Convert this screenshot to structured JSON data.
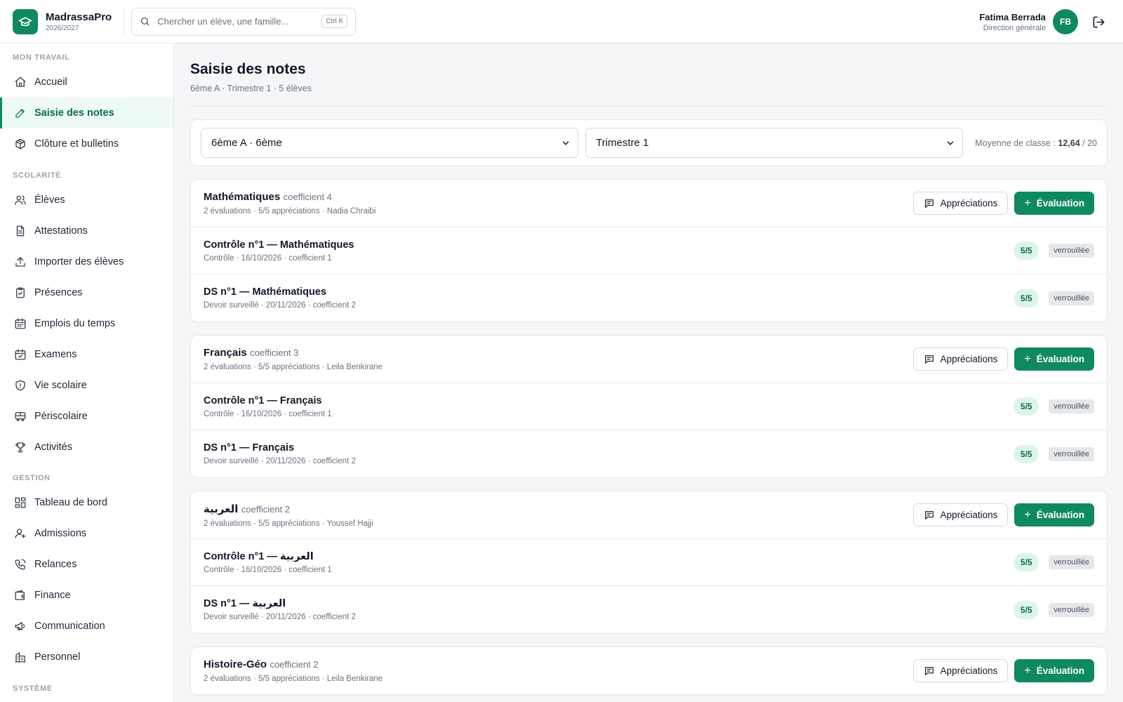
{
  "app": {
    "name": "MadrassaPro",
    "year": "2026/2027"
  },
  "search": {
    "placeholder": "Chercher un élève, une famille...",
    "shortcut": "Ctrl K"
  },
  "user": {
    "name": "Fatima Berrada",
    "role": "Direction générale",
    "initials": "FB"
  },
  "sidebar": {
    "sections": [
      {
        "title": "MON TRAVAIL",
        "items": [
          {
            "label": "Accueil",
            "icon": "home-icon"
          },
          {
            "label": "Saisie des notes",
            "icon": "pencil-icon",
            "active": true
          },
          {
            "label": "Clôture et bulletins",
            "icon": "package-icon"
          }
        ]
      },
      {
        "title": "SCOLARITÉ",
        "items": [
          {
            "label": "Élèves",
            "icon": "users-icon"
          },
          {
            "label": "Attestations",
            "icon": "document-icon"
          },
          {
            "label": "Importer des élèves",
            "icon": "upload-icon"
          },
          {
            "label": "Présences",
            "icon": "clipboard-check-icon"
          },
          {
            "label": "Emplois du temps",
            "icon": "calendar-icon"
          },
          {
            "label": "Examens",
            "icon": "calendar-check-icon"
          },
          {
            "label": "Vie scolaire",
            "icon": "shield-icon"
          },
          {
            "label": "Périscolaire",
            "icon": "bus-icon"
          },
          {
            "label": "Activités",
            "icon": "trophy-icon"
          }
        ]
      },
      {
        "title": "GESTION",
        "items": [
          {
            "label": "Tableau de bord",
            "icon": "dashboard-icon"
          },
          {
            "label": "Admissions",
            "icon": "user-plus-icon"
          },
          {
            "label": "Relances",
            "icon": "phone-icon"
          },
          {
            "label": "Finance",
            "icon": "wallet-icon"
          },
          {
            "label": "Communication",
            "icon": "megaphone-icon"
          },
          {
            "label": "Personnel",
            "icon": "building-icon"
          }
        ]
      },
      {
        "title": "SYSTÈME",
        "items": []
      }
    ]
  },
  "page": {
    "title": "Saisie des notes",
    "subtitle": "6ème A · Trimestre 1 · 5 élèves",
    "class_select": "6ème A · 6ème",
    "term_select": "Trimestre 1",
    "avg_label": "Moyenne de classe :",
    "avg_value": "12,64",
    "avg_max": "/ 20"
  },
  "actions": {
    "appreciations": "Appréciations",
    "evaluation": "Évaluation",
    "locked": "verrouillée"
  },
  "subjects": [
    {
      "name": "Mathématiques",
      "coef": "coefficient 4",
      "meta": "2 évaluations · 5/5 appréciations · Nadia Chraibi",
      "evals": [
        {
          "title": "Contrôle n°1 — Mathématiques",
          "meta": "Contrôle · 16/10/2026 · coefficient 1",
          "count": "5/5"
        },
        {
          "title": "DS n°1 — Mathématiques",
          "meta": "Devoir surveillé · 20/11/2026 · coefficient 2",
          "count": "5/5"
        }
      ]
    },
    {
      "name": "Français",
      "coef": "coefficient 3",
      "meta": "2 évaluations · 5/5 appréciations · Leila Benkirane",
      "evals": [
        {
          "title": "Contrôle n°1 — Français",
          "meta": "Contrôle · 16/10/2026 · coefficient 1",
          "count": "5/5"
        },
        {
          "title": "DS n°1 — Français",
          "meta": "Devoir surveillé · 20/11/2026 · coefficient 2",
          "count": "5/5"
        }
      ]
    },
    {
      "name": "العربية",
      "coef": "coefficient 2",
      "meta": "2 évaluations · 5/5 appréciations · Youssef Hajji",
      "evals": [
        {
          "title": "Contrôle n°1 — العربية",
          "meta": "Contrôle · 16/10/2026 · coefficient 1",
          "count": "5/5"
        },
        {
          "title": "DS n°1 — العربية",
          "meta": "Devoir surveillé · 20/11/2026 · coefficient 2",
          "count": "5/5"
        }
      ]
    },
    {
      "name": "Histoire-Géo",
      "coef": "coefficient 2",
      "meta": "2 évaluations · 5/5 appréciations · Leila Benkirane",
      "evals": []
    }
  ],
  "colors": {
    "accent": "#0f8a5f",
    "accent_soft": "#dcf5e8",
    "active_bg": "#eefaf4"
  }
}
